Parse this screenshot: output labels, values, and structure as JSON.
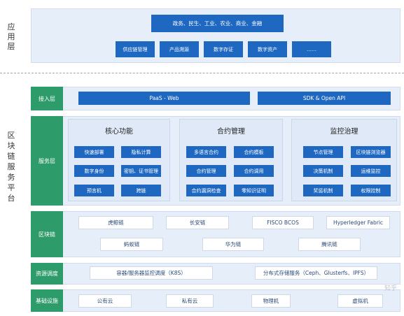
{
  "side": {
    "app_layer": [
      "应",
      "用",
      "层"
    ],
    "platform": [
      "区",
      "块",
      "链",
      "服",
      "务",
      "平",
      "台"
    ]
  },
  "application": {
    "top_bar": "政务、民生、工业、农业、商业、金融",
    "items": [
      "供应链管理",
      "产品溯源",
      "数字存证",
      "数字资产",
      "……"
    ]
  },
  "access_layer": {
    "label": "接入层",
    "items": [
      "PaaS - Web",
      "SDK & Open API"
    ]
  },
  "service_layer": {
    "label": "服务层",
    "groups": [
      {
        "title": "核心功能",
        "items": [
          "快速部署",
          "隐私计算",
          "数字身份",
          "密钥、证书管理",
          "预言机",
          "跨链"
        ]
      },
      {
        "title": "合约管理",
        "items": [
          "多语言合约",
          "合约模板",
          "合约管理",
          "合约调用",
          "合约漏洞检查",
          "零知识证明"
        ]
      },
      {
        "title": "监控治理",
        "items": [
          "节点管理",
          "区块链浏览器",
          "决策机制",
          "运维监控",
          "奖惩机制",
          "权限控制"
        ]
      }
    ]
  },
  "blockchain_layer": {
    "label": "区块链",
    "row1": [
      "虎鲸链",
      "长安链",
      "FISCO BCOS",
      "Hyperledger Fabric"
    ],
    "row2": [
      "蚂蚁链",
      "华为链",
      "腾讯链"
    ]
  },
  "resource_layer": {
    "label": "资源调度",
    "items": [
      "容器/服务器监控调度（K8S）",
      "分布式存储服务（Ceph、Glusterfs、IPFS）"
    ]
  },
  "infra_layer": {
    "label": "基础设施",
    "items": [
      "公有云",
      "私有云",
      "物理机",
      "虚拟机"
    ]
  },
  "watermark": "知乎",
  "colors": {
    "green": "#2e9b6a",
    "blue": "#1f68c2",
    "panel": "#e6eef9"
  }
}
